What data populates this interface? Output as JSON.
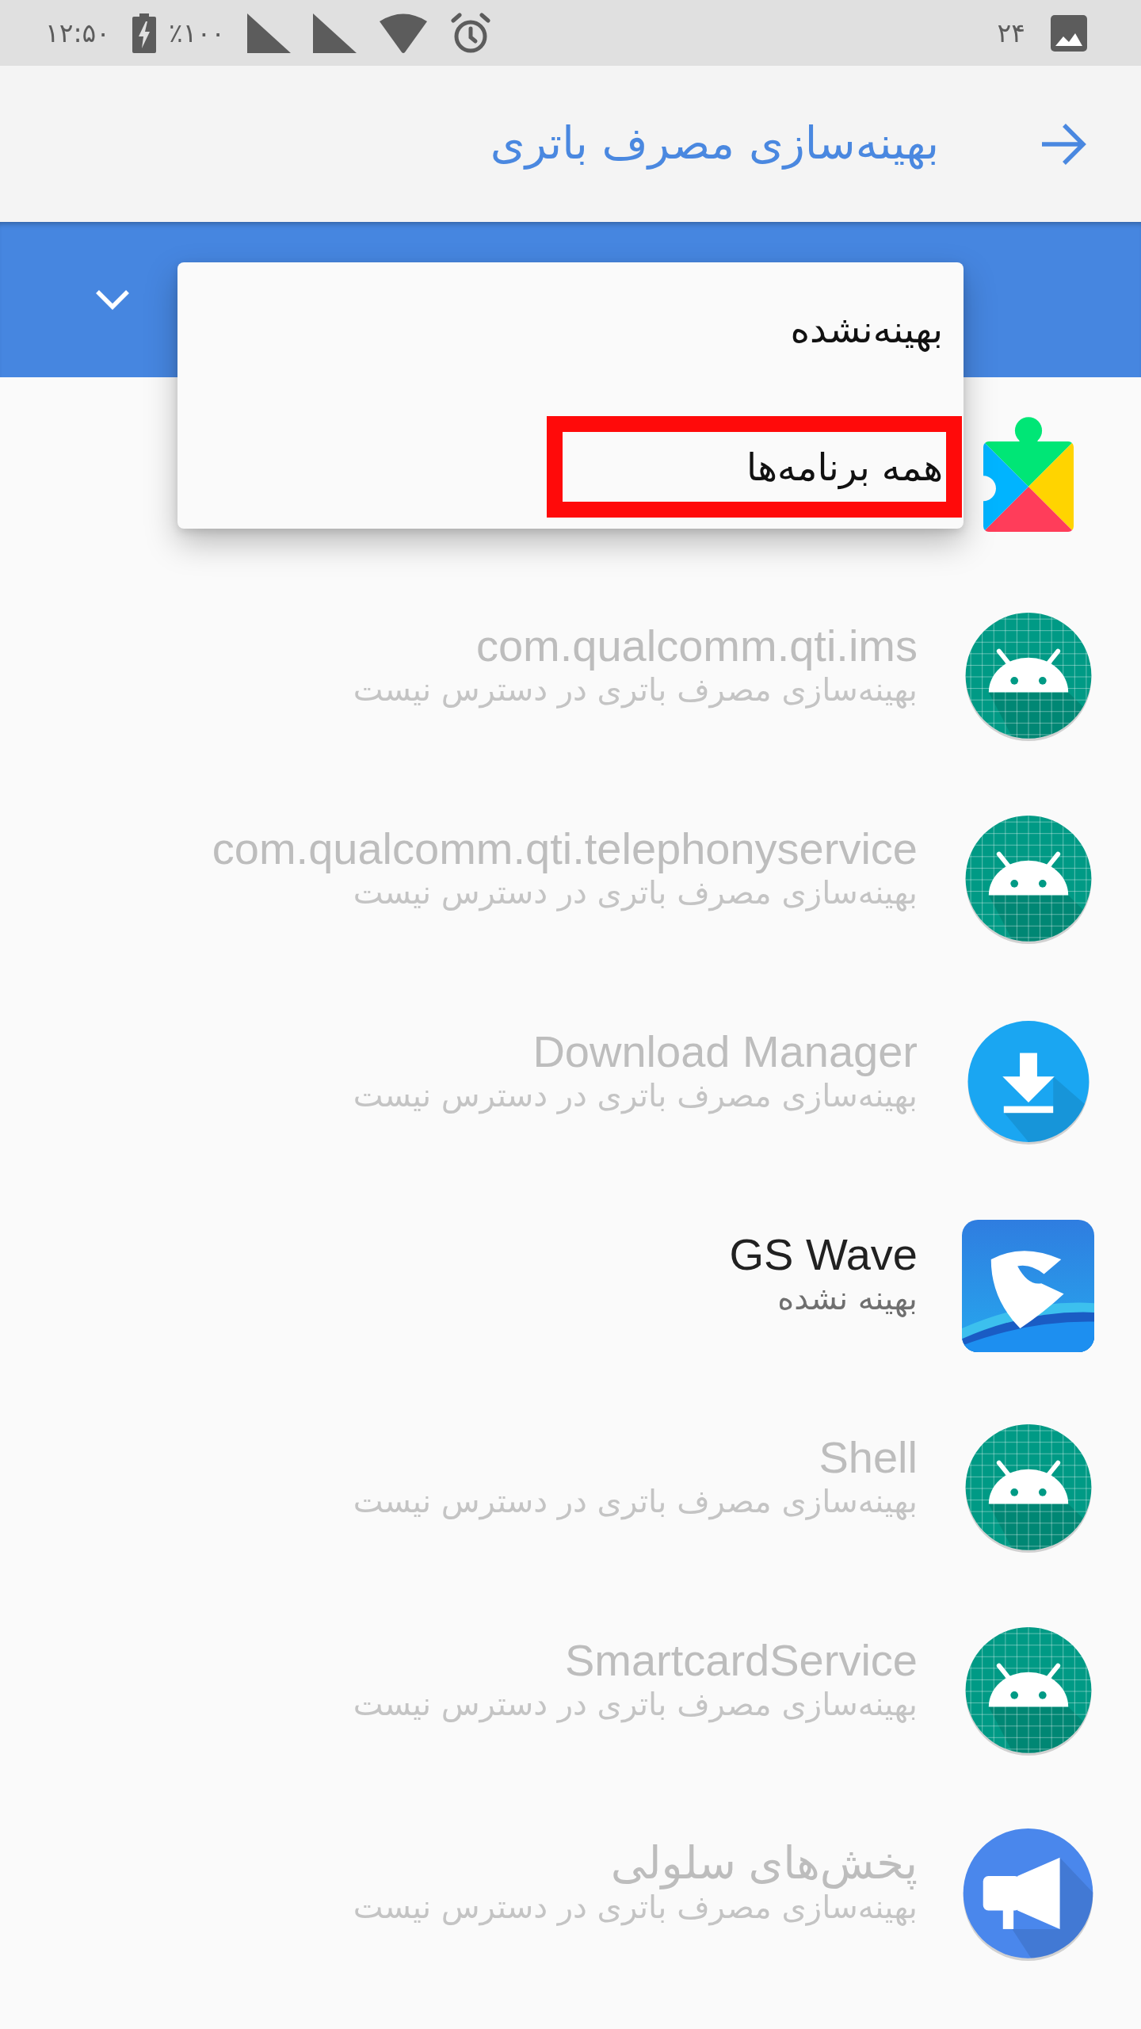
{
  "status_bar": {
    "time": "۱۲:۵۰",
    "battery_percent": "٪۱۰۰",
    "notification_number": "۲۴"
  },
  "header": {
    "title": "بهینه‌سازی مصرف باتری"
  },
  "filter_menu": {
    "items": [
      {
        "label": "بهینه‌نشده",
        "highlighted": false
      },
      {
        "label": "همه برنامه‌ها",
        "highlighted": true
      }
    ]
  },
  "apps": [
    {
      "kind": "puzzle"
    },
    {
      "kind": "android",
      "name": "com.qualcomm.qti.ims",
      "status": "بهینه‌سازی مصرف باتری در دسترس نیست",
      "disabled": true
    },
    {
      "kind": "android",
      "name": "com.qualcomm.qti.telephonyservice",
      "status": "بهینه‌سازی مصرف باتری در دسترس نیست",
      "disabled": true
    },
    {
      "kind": "download",
      "name": "Download Manager",
      "status": "بهینه‌سازی مصرف باتری در دسترس نیست",
      "disabled": true
    },
    {
      "kind": "wave",
      "name": "GS Wave",
      "status": "بهینه نشده",
      "disabled": false
    },
    {
      "kind": "android",
      "name": "Shell",
      "status": "بهینه‌سازی مصرف باتری در دسترس نیست",
      "disabled": true
    },
    {
      "kind": "android",
      "name": "SmartcardService",
      "status": "بهینه‌سازی مصرف باتری در دسترس نیست",
      "disabled": true
    },
    {
      "kind": "megaphone",
      "name": "پخش‌های سلولی",
      "status": "بهینه‌سازی مصرف باتری در دسترس نیست",
      "disabled": true
    }
  ]
}
